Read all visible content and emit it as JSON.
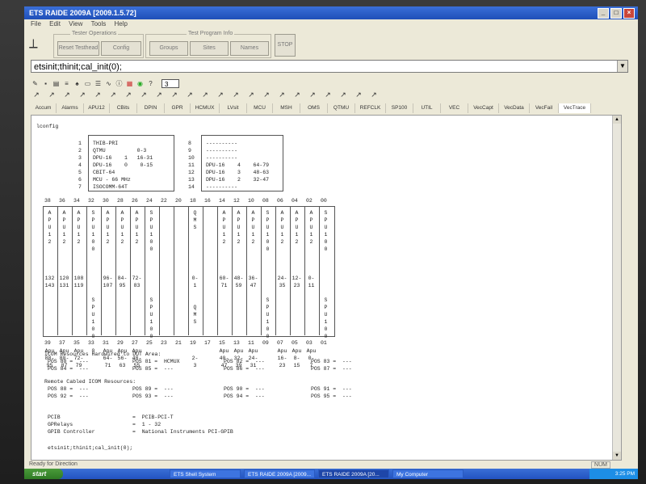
{
  "window": {
    "title": "ETS RAIDE 2009A [2009.1.5.72]"
  },
  "menu": [
    "File",
    "Edit",
    "View",
    "Tools",
    "Help"
  ],
  "tester_operations": {
    "label": "Tester Operations",
    "buttons": [
      "Reset Testhead",
      "Config"
    ]
  },
  "test_program_info": {
    "label": "Test Program Info",
    "buttons": [
      "Groups",
      "Sites",
      "Names"
    ]
  },
  "stop_label": "STOP",
  "command": {
    "value": "etsinit;thinit;cal_init(0);"
  },
  "toolbar": {
    "site_select": "3"
  },
  "tabs": [
    "Accum",
    "Alarms",
    "APU12",
    "CBits",
    "DPIN",
    "GPR",
    "HCMUX",
    "LVsit",
    "MCU",
    "MSH",
    "OMS",
    "QTMU",
    "REFCLK",
    "SP100",
    "UTIL",
    "VEC",
    "VecCapt",
    "VecData",
    "VecFail",
    "VecTrace"
  ],
  "output": {
    "heading": "lconfig",
    "left_numbers": [
      "1",
      "2",
      "3",
      "4",
      "5",
      "6",
      "7"
    ],
    "left_entries": [
      "THIB-PRI",
      "QTMU          0-3",
      "DPU-16    1   16-31",
      "DPU-16    0    0-15",
      "CBIT-64",
      "MCU - 66 MHz",
      "ISOCOMM-64T"
    ],
    "right_numbers": [
      "8",
      "9",
      "10",
      "11",
      "12",
      "13",
      "14"
    ],
    "right_entries": [
      "----------",
      "----------",
      "----------",
      "DPU-16    4    64-79",
      "DPU-16    3    48-63",
      "DPU-16    2    32-47",
      "----------"
    ],
    "top_positions": [
      "38",
      "36",
      "34",
      "32",
      "30",
      "28",
      "26",
      "24",
      "22",
      "20",
      "18",
      "16",
      "14",
      "12",
      "10",
      "08",
      "06",
      "04",
      "02",
      "00"
    ],
    "bottom_positions": [
      "39",
      "37",
      "35",
      "33",
      "31",
      "29",
      "27",
      "25",
      "23",
      "21",
      "19",
      "17",
      "15",
      "13",
      "11",
      "09",
      "07",
      "05",
      "03",
      "01"
    ],
    "slot_columns": [
      "A\nP\nU\n1\n2\n\n\n\n\n132\n143\n\n\n\n\n\n\n\n\nApu\n88-\n95",
      "A\nP\nU\n1\n2\n\n\n\n\n120\n131\n\n\n\n\n\n\n\n\nApu\n80-\n87",
      "A\nP\nU\n1\n2\n\n\n\n\n108\n119\n\n\n\n\n\n\n\n\nApu\n72-\n79",
      "S\nP\nU\n1\n0\n0\n\n\n\n\n\n\nS\nP\nU\n1\n0\n0\n\n0",
      "A\nP\nU\n1\n2\n\n\n\n\n96-\n107\n\n\n\n\n\n\n\n\nApu\n64-\n71",
      "A\nP\nU\n1\n2\n\n\n\n\n84-\n95\n\n\n\n\n\n\n\n\nApu\n56-\n63",
      "A\nP\nU\n1\n2\n\n\n\n\n72-\n83\n\n\n\n\n\n\n\n\nApu\n48-\n55",
      "S\nP\nU\n1\n0\n0\n\n\n\n\n\n\nS\nP\nU\n1\n0\n0",
      "",
      "",
      "Q\nM\nS\n\n\n\n\n\n\n0-\n1\n\n\nQ\nM\nS\n\n\n\n\n2-\n3",
      "",
      "A\nP\nU\n1\n2\n\n\n\n\n60-\n71\n\n\n\n\n\n\n\n\nApu\n40-\n47",
      "A\nP\nU\n1\n2\n\n\n\n\n48-\n59\n\n\n\n\n\n\n\n\nApu\n32-\n39",
      "A\nP\nU\n1\n2\n\n\n\n\n36-\n47\n\n\n\n\n\n\n\n\nApu\n24-\n31",
      "S\nP\nU\n1\n0\n0\n\n\n\n\n\n\nS\nP\nU\n1\n0\n0",
      "A\nP\nU\n1\n2\n\n\n\n\n24-\n35\n\n\n\n\n\n\n\n\nApu\n16-\n23",
      "A\nP\nU\n1\n2\n\n\n\n\n12-\n23\n\n\n\n\n\n\n\n\nApu\n8-\n15",
      "A\nP\nU\n1\n2\n\n\n\n\n0-\n11\n\n\n\n\n\n\n\n\nApu\n0-\n7",
      "S\nP\nU\n1\n0\n0\n\n\n\n\n\n\nS\nP\nU\n1\n0\n0"
    ],
    "icom_hardwired_title": "ICOM Resources Hardwired to DUT Area:",
    "icom_rows": [
      [
        "POS 80 =  ---",
        "POS 81 =  HCMUX",
        "POS 82 =  ---",
        "POS 83 =  ---"
      ],
      [
        "POS 84 =  ---",
        "POS 85 =  ---",
        "POS 86 =  ---",
        "POS 87 =  ---"
      ]
    ],
    "remote_title": "Remote Cabled ICOM Resources:",
    "remote_rows": [
      [
        "POS 88 =  ---",
        "POS 89 =  ---",
        "POS 90 =  ---",
        "POS 91 =  ---"
      ],
      [
        "POS 92 =  ---",
        "POS 93 =  ---",
        "POS 94 =  ---",
        "POS 95 =  ---"
      ]
    ],
    "info_rows": [
      [
        "PCIB",
        "=  PCIB-PCI-T"
      ],
      [
        "GPRelays",
        "=  1 - 32"
      ],
      [
        "GPIB Controller",
        "=  National Instruments PCI-GPIB"
      ]
    ],
    "echo": "etsinit;thinit;cal_init(0);"
  },
  "status": {
    "text": "Ready for Direction",
    "num": "NUM"
  },
  "taskbar": {
    "start": "start",
    "tasks": [
      "ETS Shell System",
      "ETS RAIDE 2009A [2009...",
      "ETS RAIDE 2009A [20...",
      "My Computer"
    ],
    "clock": "3:25 PM"
  }
}
